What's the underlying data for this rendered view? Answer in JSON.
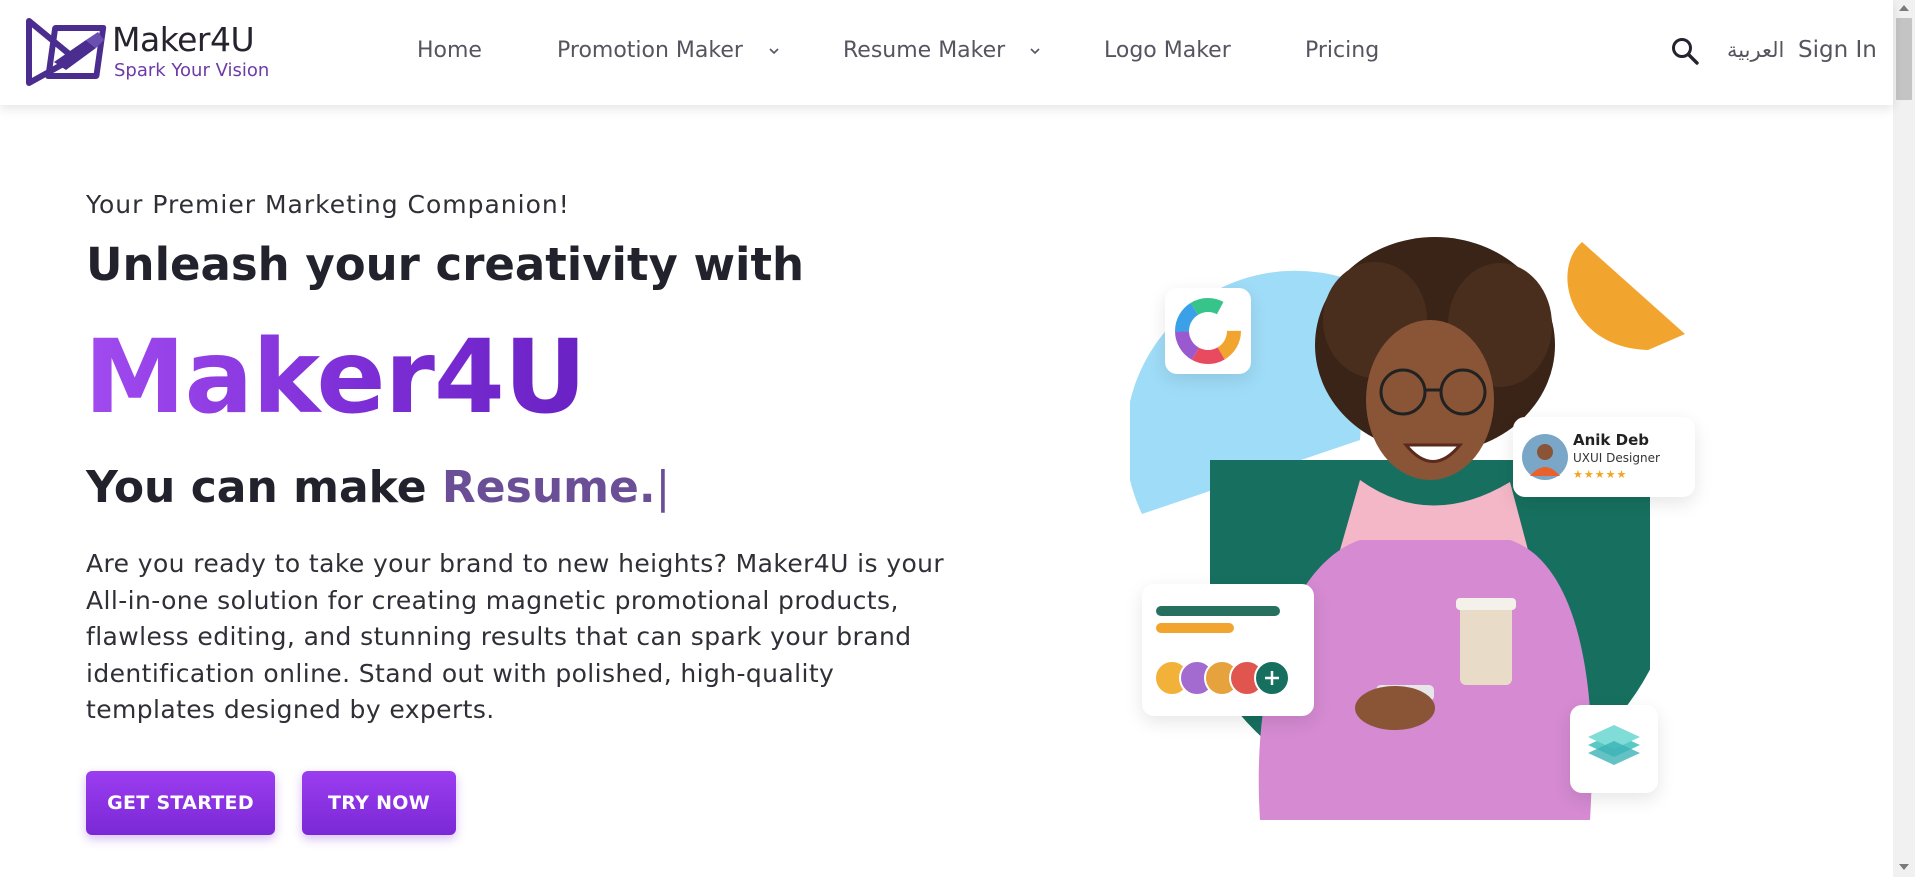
{
  "brand": {
    "name": "Maker4U",
    "tagline": "Spark Your Vision",
    "colors": {
      "primary": "#7a28d6",
      "accent": "#a14bf0",
      "teal": "#17705f",
      "sky": "#9fdcf7",
      "orange": "#f2a52e"
    }
  },
  "nav": {
    "items": [
      {
        "label": "Home",
        "has_dropdown": false
      },
      {
        "label": "Promotion Maker",
        "has_dropdown": true
      },
      {
        "label": "Resume Maker",
        "has_dropdown": true
      },
      {
        "label": "Logo Maker",
        "has_dropdown": false
      },
      {
        "label": "Pricing",
        "has_dropdown": false
      }
    ],
    "search_icon": "search-icon",
    "language": "العربية",
    "sign_in": "Sign In"
  },
  "hero": {
    "eyebrow": "Your Premier Marketing Companion!",
    "headline": "Unleash your creativity with",
    "brand_big": "Maker4U",
    "make_prefix": "You can make",
    "make_typed": "Resume.",
    "make_caret": "|",
    "description": "Are you ready to take your brand to new heights? Maker4U is your All-in-one solution for creating magnetic promotional products, flawless editing, and stunning results that can spark your brand identification online. Stand out with polished, high-quality templates designed by experts.",
    "buttons": {
      "get_started": "GET STARTED",
      "try_now": "TRY NOW"
    }
  },
  "illustration": {
    "profile_card": {
      "name": "Anik Deb",
      "role": "UXUI Designer",
      "stars": "★★★★★",
      "rating": 5
    },
    "icons": [
      "color-wheel-icon",
      "layers-icon",
      "plus-icon"
    ]
  }
}
